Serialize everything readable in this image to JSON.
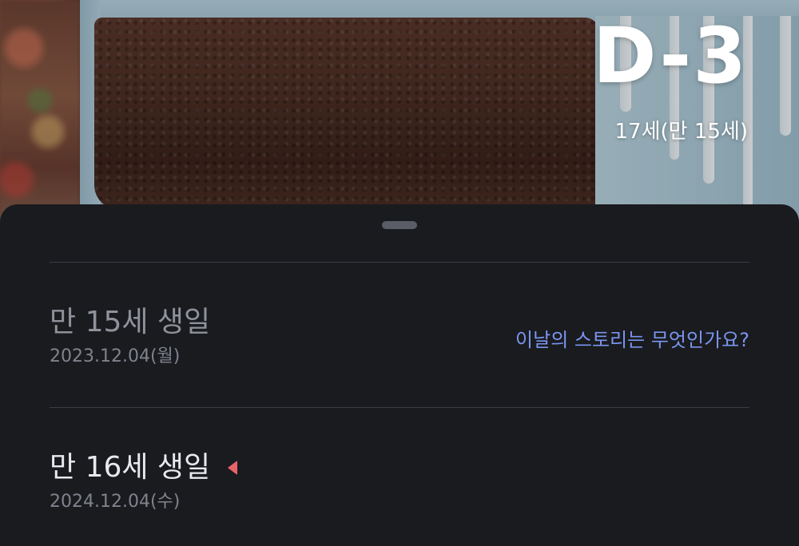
{
  "hero": {
    "dday": "D-3",
    "age_line": "17세(만 15세)"
  },
  "sheet": {
    "items": [
      {
        "title": "만 15세 생일",
        "date": "2023.12.04(월)",
        "story_link": "이날의 스토리는 무엇인가요?"
      },
      {
        "title": "만 16세 생일",
        "date": "2024.12.04(수)"
      }
    ]
  },
  "colors": {
    "sheet_background": "#1a1b1f",
    "link": "#7a95ee",
    "marker": "#e8646a",
    "muted_text": "#8f929b",
    "current_text": "#e8e9ee"
  },
  "icons": {
    "current_marker": "triangle-marker-icon",
    "sheet_handle": "drag-handle-icon"
  }
}
